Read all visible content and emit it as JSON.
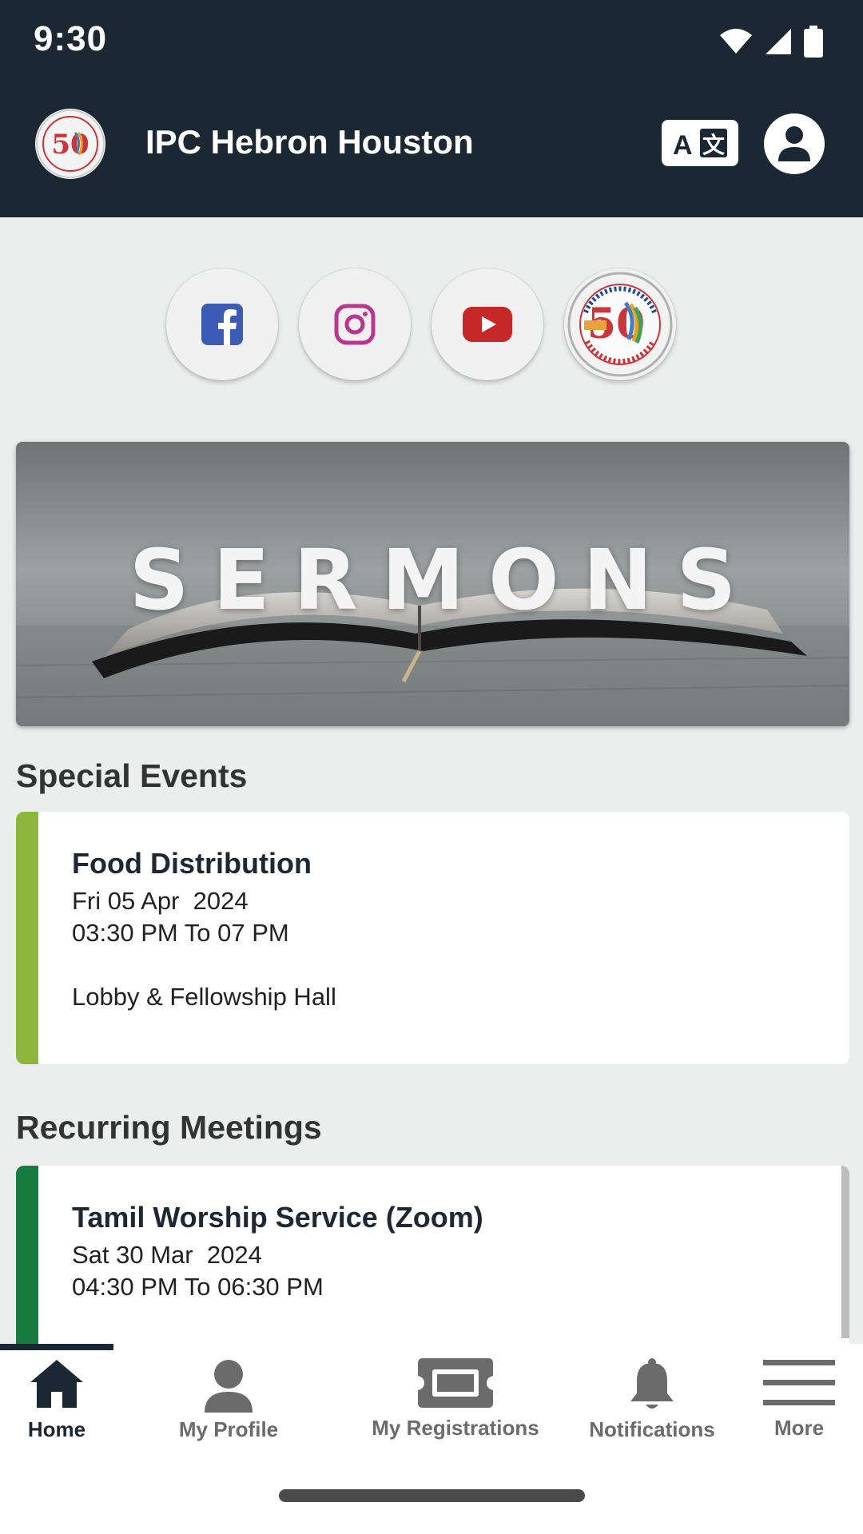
{
  "status_bar": {
    "time": "9:30"
  },
  "app_bar": {
    "title": "IPC Hebron Houston"
  },
  "social": [
    {
      "name": "facebook",
      "icon": "facebook-icon"
    },
    {
      "name": "instagram",
      "icon": "instagram-icon"
    },
    {
      "name": "youtube",
      "icon": "youtube-icon"
    },
    {
      "name": "church-website",
      "icon": "golden-jubilee-logo"
    }
  ],
  "banner": {
    "text": "SERMONS"
  },
  "special_events": {
    "title": "Special Events",
    "items": [
      {
        "title": "Food Distribution",
        "date": "Fri 05 Apr  2024",
        "time": "03:30 PM To 07 PM",
        "location": "Lobby & Fellowship Hall",
        "accent_color": "#8cb63c"
      }
    ]
  },
  "recurring_meetings": {
    "title": "Recurring Meetings",
    "items": [
      {
        "title": "Tamil Worship Service (Zoom)",
        "date": "Sat 30 Mar  2024",
        "time": "04:30 PM To 06:30 PM",
        "accent_color": "#177a3e"
      }
    ]
  },
  "bottom_nav": {
    "items": [
      {
        "label": "Home",
        "icon": "home-icon",
        "active": true
      },
      {
        "label": "My Profile",
        "icon": "person-icon",
        "active": false
      },
      {
        "label": "My Registrations",
        "icon": "ticket-icon",
        "active": false
      },
      {
        "label": "Notifications",
        "icon": "bell-icon",
        "active": false
      },
      {
        "label": "More",
        "icon": "menu-icon",
        "active": false
      }
    ]
  },
  "colors": {
    "app_bar": "#1b2733",
    "background": "#eceeee",
    "special_accent": "#8cb63c",
    "recurring_accent": "#177a3e"
  }
}
